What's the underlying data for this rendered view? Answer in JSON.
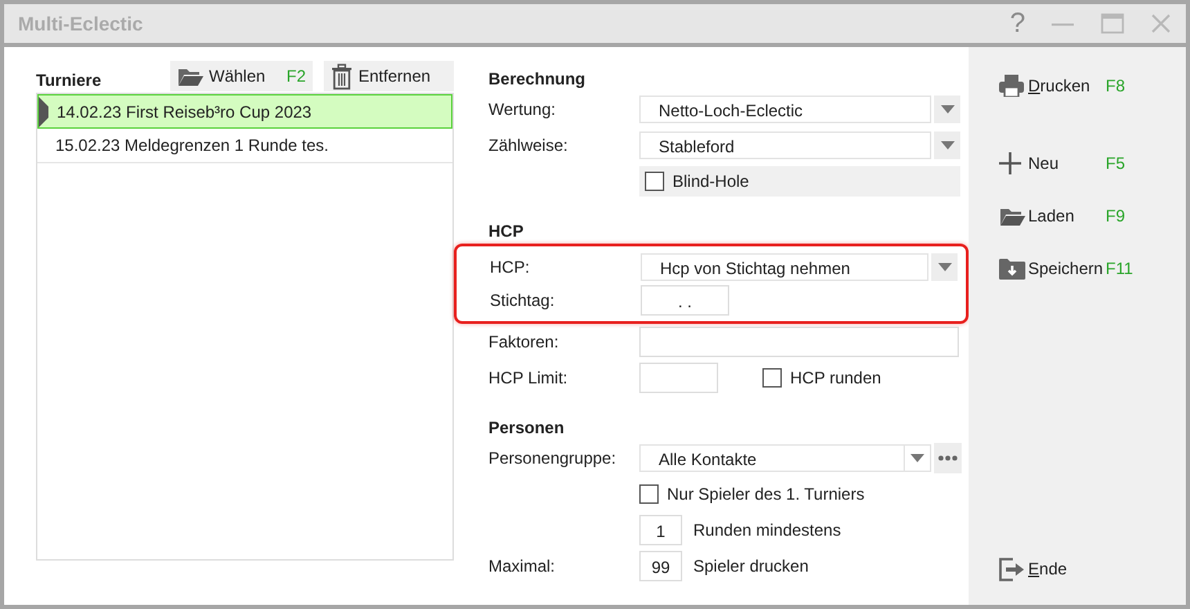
{
  "window": {
    "title": "Multi-Eclectic",
    "help": "?"
  },
  "tournaments": {
    "title": "Turniere",
    "buttons": [
      {
        "kind": "select",
        "label": "Wählen",
        "key": "F2"
      },
      {
        "kind": "remove",
        "label": "Entfernen"
      }
    ],
    "rows": [
      {
        "text": "14.02.23 First Reiseb³ro Cup 2023",
        "selected": true
      },
      {
        "text": "15.02.23 Meldegrenzen 1 Runde tes.",
        "selected": false
      }
    ]
  },
  "sections": [
    {
      "title": "Berechnung",
      "rows": [
        {
          "kind": "select",
          "label": "Wertung:",
          "value": "Netto-Loch-Eclectic"
        },
        {
          "kind": "select",
          "label": "Zählweise:",
          "value": "Stableford"
        },
        {
          "kind": "check",
          "check_label": "Blind-Hole",
          "checked": false,
          "panel": true
        }
      ]
    },
    {
      "title": "HCP",
      "rows": [
        {
          "kind": "highlight_group",
          "rows": [
            {
              "kind": "select",
              "label": "HCP:",
              "value": "Hcp von Stichtag nehmen"
            },
            {
              "kind": "date",
              "label": "Stichtag:",
              "value": ". ."
            }
          ]
        },
        {
          "kind": "text",
          "label": "Faktoren:"
        },
        {
          "kind": "text_check",
          "label": "HCP Limit:",
          "check_label": "HCP runden",
          "checked": false
        }
      ]
    },
    {
      "title": "Personen",
      "rows": [
        {
          "kind": "select",
          "label": "Personengruppe:",
          "value": "Alle Kontakte",
          "more": true
        },
        {
          "kind": "check",
          "check_label": "Nur Spieler des 1. Turniers",
          "checked": false,
          "panel": false
        },
        {
          "kind": "number",
          "value": "1",
          "suffix": "Runden mindestens"
        },
        {
          "kind": "number",
          "label": "Maximal:",
          "value": "99",
          "suffix": "Spieler drucken"
        }
      ]
    }
  ],
  "sidebar": {
    "groups": [
      [
        {
          "kind": "print",
          "label": "Drucken",
          "key": "F8",
          "underlined": true
        }
      ],
      [
        {
          "kind": "new",
          "label": "Neu",
          "key": "F5",
          "underlined": false
        },
        {
          "kind": "load",
          "label": "Laden",
          "key": "F9",
          "underlined": false
        },
        {
          "kind": "save",
          "label": "Speichern",
          "key": "F11",
          "underlined": false
        }
      ]
    ],
    "footer": {
      "kind": "exit",
      "label": "Ende",
      "underlined": true
    }
  }
}
